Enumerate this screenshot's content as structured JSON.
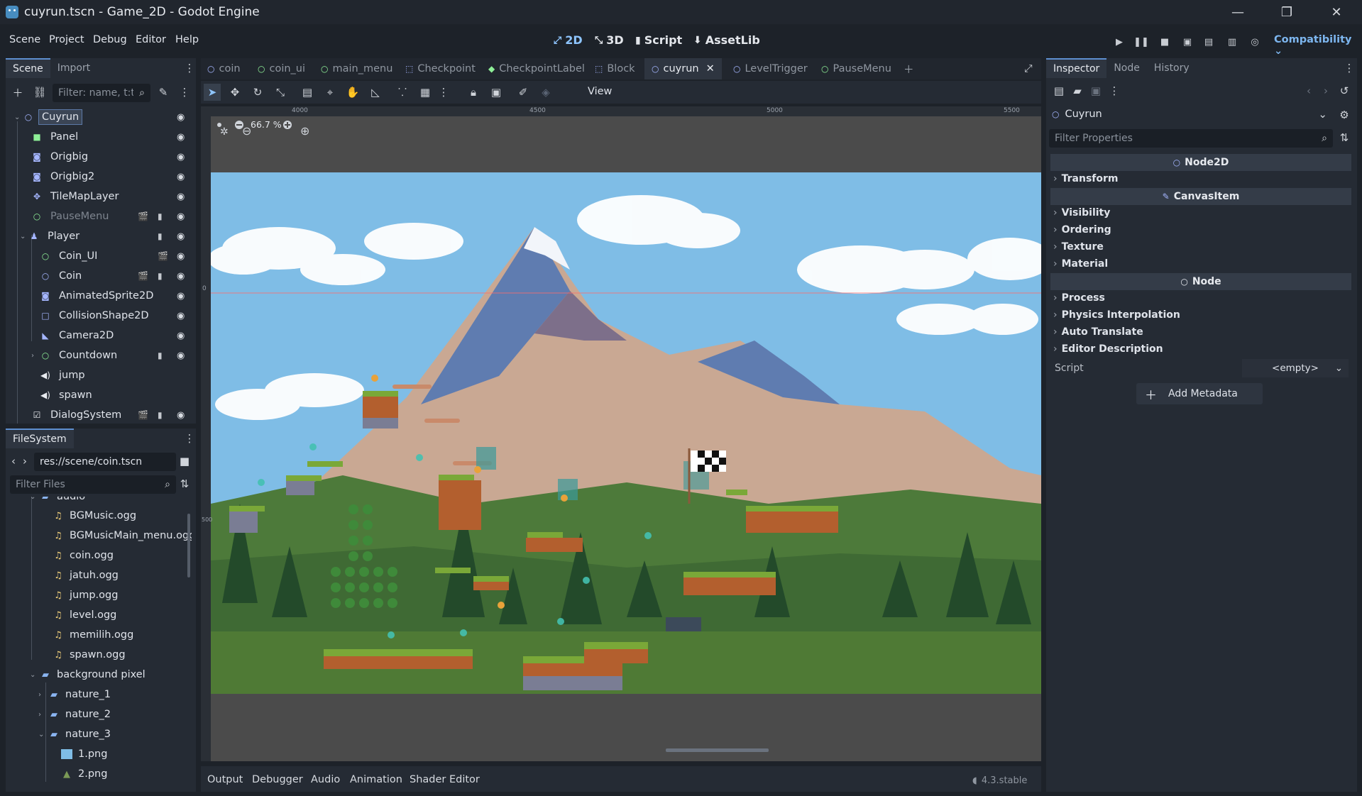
{
  "window": {
    "title": "cuyrun.tscn - Game_2D - Godot Engine"
  },
  "menubar": {
    "items": [
      "Scene",
      "Project",
      "Debug",
      "Editor",
      "Help"
    ],
    "workspaces": [
      "2D",
      "3D",
      "Script",
      "AssetLib"
    ],
    "renderer": "Compatibility"
  },
  "scene_dock": {
    "tabs": [
      "Scene",
      "Import"
    ],
    "filter_placeholder": "Filter: name, t:t",
    "nodes": [
      "Cuyrun",
      "Panel",
      "Origbig",
      "Origbig2",
      "TileMapLayer",
      "PauseMenu",
      "Player",
      "Coin_UI",
      "Coin",
      "AnimatedSprite2D",
      "CollisionShape2D",
      "Camera2D",
      "Countdown",
      "jump",
      "spawn",
      "DialogSystem"
    ]
  },
  "filesystem": {
    "tab": "FileSystem",
    "path": "res://scene/coin.tscn",
    "filter_placeholder": "Filter Files",
    "items": [
      "audio",
      "BGMusic.ogg",
      "BGMusicMain_menu.ogg",
      "coin.ogg",
      "jatuh.ogg",
      "jump.ogg",
      "level.ogg",
      "memilih.ogg",
      "spawn.ogg",
      "background pixel",
      "nature_1",
      "nature_2",
      "nature_3",
      "1.png",
      "2.png"
    ]
  },
  "editor_tabs": [
    "coin",
    "coin_ui",
    "main_menu",
    "Checkpoint",
    "CheckpointLabel",
    "Block",
    "cuyrun",
    "LevelTrigger",
    "PauseMenu"
  ],
  "toolbar": {
    "view_label": "View"
  },
  "viewport": {
    "zoom": "66.7 %",
    "ruler_labels": [
      "4000",
      "4500",
      "5000",
      "5500"
    ],
    "ruler_v_labels": [
      "0",
      "500"
    ]
  },
  "inspector": {
    "tabs": [
      "Inspector",
      "Node",
      "History"
    ],
    "node_name": "Cuyrun",
    "filter_placeholder": "Filter Properties",
    "sections": [
      "Node2D",
      "CanvasItem",
      "Node"
    ],
    "groups": [
      "Transform",
      "Visibility",
      "Ordering",
      "Texture",
      "Material",
      "Process",
      "Physics Interpolation",
      "Auto Translate",
      "Editor Description"
    ],
    "script_label": "Script",
    "script_value": "<empty>",
    "add_metadata": "Add Metadata"
  },
  "bottom_panel": {
    "tabs": [
      "Output",
      "Debugger",
      "Audio",
      "Animation",
      "Shader Editor"
    ],
    "version": "4.3.stable"
  },
  "colors": {
    "accent": "#5e8fd0",
    "bg": "#1d2229",
    "panel": "#252b34",
    "sky": "#7fbde6"
  }
}
